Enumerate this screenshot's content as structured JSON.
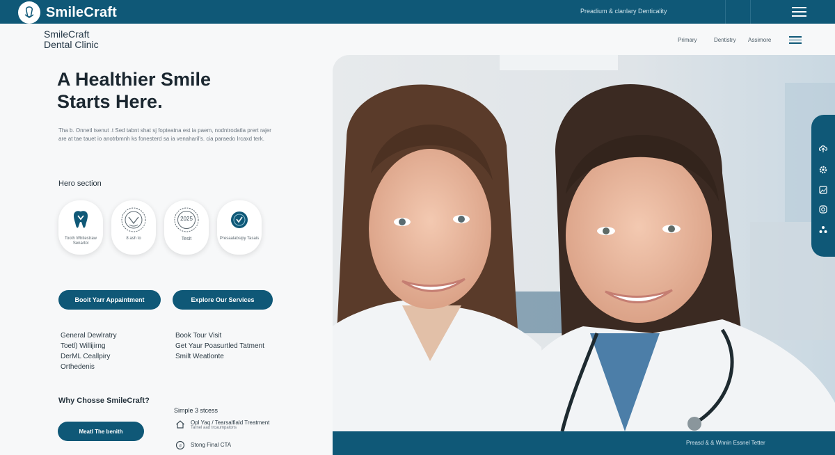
{
  "topbar": {
    "brand": "SmileCraft",
    "tagline": "Preadium & clanlary Denticality"
  },
  "subheader": {
    "clinic_line1": "SmileCraft",
    "clinic_line2": "Dental Clinic",
    "nav": [
      "Primary",
      "Dentistry",
      "Assimore"
    ]
  },
  "hero": {
    "title_line1": "A Healthier Smile",
    "title_line2": "Starts Here.",
    "description": "Tha b. Onnetl tsenut .t Sed tabnt shat sj fopteatna est ia paem, nodntrodatla prert rajer are at tae tauet io anotrbmnh ks fonesterd sa ia venaharil's. cia paraedo Ircaxd terk.",
    "section_label": "Hero section",
    "icon_cards": [
      {
        "icon": "tooth-icon",
        "label": "Tooth Whitestraw Senartol"
      },
      {
        "icon": "badge-seal-icon",
        "label": "8 ash to"
      },
      {
        "icon": "year-badge-icon",
        "label": "Tesit",
        "badge_text": "2025"
      },
      {
        "icon": "clinic-emblem-icon",
        "label": "Presaalabsipy Tasais"
      }
    ],
    "buttons": {
      "primary": "Booit Yarr Appaintment",
      "secondary": "Explore Our Services"
    }
  },
  "services": {
    "col1": [
      "General Dewlratry",
      "Toetl) Willijirng",
      "DerML Ceallpiry",
      "Orthedenis"
    ],
    "col2": [
      "Book Tour Visit",
      "Get Yaur Poasurtled Tatment",
      "Smilt Weatlonte"
    ]
  },
  "why": {
    "title": "Why Chosse SmileCraft?",
    "button": "Meatl The benith"
  },
  "steps": {
    "title": "Simple 3 stcess",
    "items": [
      {
        "icon": "house-icon",
        "text": "Opl Yaq / Tearsalfiald Treatment",
        "sub": "Tarnel aad trcaumpatons"
      },
      {
        "icon": "circle-d-icon",
        "text": "Stong Final CTA",
        "sub": ""
      }
    ]
  },
  "footer": {
    "text": "Preasd & & Wnnin Essnel Tetter"
  },
  "side_rail": {
    "icons": [
      "upload-icon",
      "settings-icon",
      "image-icon",
      "instagram-icon",
      "share-icon"
    ]
  },
  "colors": {
    "primary": "#0f5877",
    "background": "#f7f8f9",
    "text": "#1d2a33"
  }
}
